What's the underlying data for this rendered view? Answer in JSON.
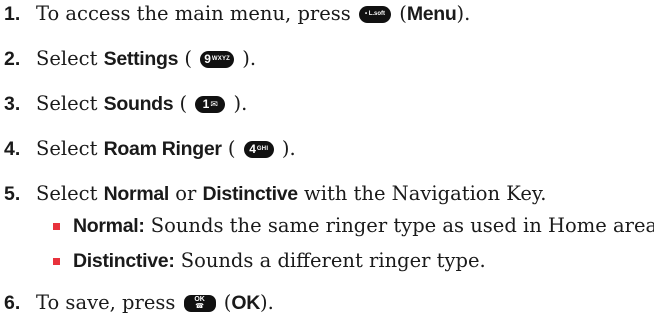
{
  "steps": [
    {
      "num": "1.",
      "pre": "To access the main menu, press ",
      "key": "• L.soft",
      "post_open": " (",
      "bold": "Menu",
      "post_close": ")."
    },
    {
      "num": "2.",
      "pre": "Select ",
      "bold": "Settings",
      "mid": " ( ",
      "key_main": "9",
      "key_sub": "WXYZ",
      "post": " )."
    },
    {
      "num": "3.",
      "pre": "Select ",
      "bold": "Sounds",
      "mid": " ( ",
      "key_main": "1",
      "key_sub": "✉",
      "post": " )."
    },
    {
      "num": "4.",
      "pre": "Select ",
      "bold": "Roam Ringer",
      "mid": " ( ",
      "key_main": "4",
      "key_sub": "GHI",
      "post": " )."
    },
    {
      "num": "5.",
      "pre": "Select ",
      "bold1": "Normal",
      "mid": " or ",
      "bold2": "Distinctive",
      "post": " with the Navigation Key."
    },
    {
      "num": "6.",
      "pre": "To save, press ",
      "key_top": "OK",
      "key_bottom": "☎",
      "post_open": " (",
      "bold": "OK",
      "post_close": ")."
    }
  ],
  "bullets": [
    {
      "bold": "Normal:",
      "text": " Sounds the same ringer type as used in Home area."
    },
    {
      "bold": "Distinctive:",
      "text": " Sounds a different ringer type."
    }
  ],
  "colors": {
    "bullet": "#e8323c",
    "key_bg": "#111111"
  }
}
